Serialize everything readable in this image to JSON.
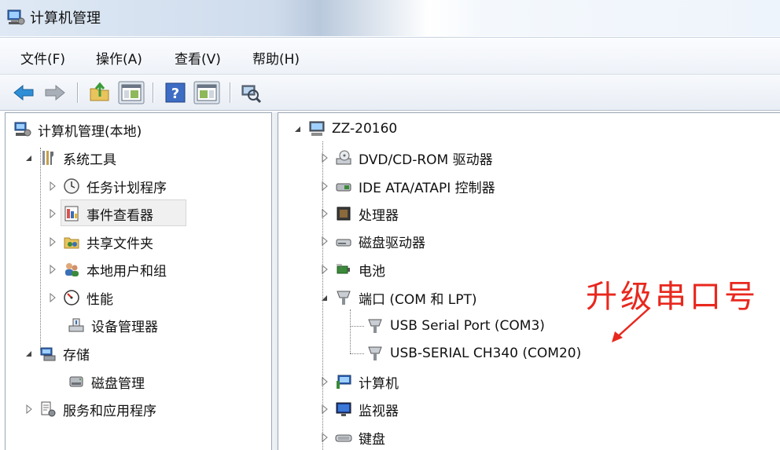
{
  "window": {
    "title": "计算机管理"
  },
  "menu": [
    "文件(F)",
    "操作(A)",
    "查看(V)",
    "帮助(H)"
  ],
  "toolbar": [
    "back-icon",
    "forward-icon",
    "up-folder-icon",
    "show-hide-tree-icon",
    "help-icon",
    "properties-icon",
    "scan-hardware-icon"
  ],
  "left_tree": {
    "root": "计算机管理(本地)",
    "system_tools": "系统工具",
    "task_scheduler": "任务计划程序",
    "event_viewer": "事件查看器",
    "shared_folders": "共享文件夹",
    "local_users": "本地用户和组",
    "performance": "性能",
    "device_manager": "设备管理器",
    "storage": "存储",
    "disk_management": "磁盘管理",
    "services": "服务和应用程序"
  },
  "right_tree": {
    "computer_name": "ZZ-20160",
    "dvd": "DVD/CD-ROM 驱动器",
    "ide": "IDE ATA/ATAPI 控制器",
    "processor": "处理器",
    "disk_drives": "磁盘驱动器",
    "battery": "电池",
    "ports": "端口 (COM 和 LPT)",
    "usb_serial_port": "USB Serial Port (COM3)",
    "usb_serial_ch340": "USB-SERIAL CH340 (COM20)",
    "computer": "计算机",
    "monitors": "监视器",
    "keyboard": "键盘"
  },
  "annotation": {
    "text": "升级串口号",
    "color": "#e8281e"
  }
}
